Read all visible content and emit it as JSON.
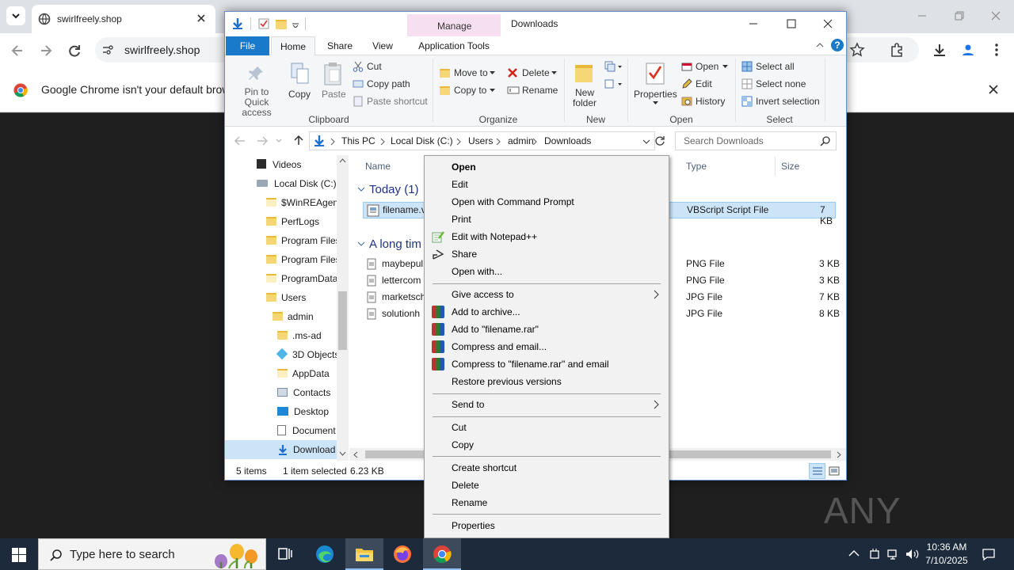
{
  "browser": {
    "tab_title": "swirlfreely.shop",
    "url": "swirlfreely.shop",
    "infobar_text": "Google Chrome isn't your default browser"
  },
  "explorer": {
    "title": "Downloads",
    "manage_tab": "Manage",
    "ribbon_tabs": [
      "File",
      "Home",
      "Share",
      "View",
      "Application Tools"
    ],
    "ribbon": {
      "pin": "Pin to Quick access",
      "copy": "Copy",
      "paste": "Paste",
      "cut": "Cut",
      "copy_path": "Copy path",
      "paste_shortcut": "Paste shortcut",
      "move_to": "Move to",
      "copy_to": "Copy to",
      "delete": "Delete",
      "rename": "Rename",
      "new_folder": "New folder",
      "properties": "Properties",
      "open": "Open",
      "edit": "Edit",
      "history": "History",
      "select_all": "Select all",
      "select_none": "Select none",
      "invert_selection": "Invert selection",
      "groups": [
        "Clipboard",
        "Organize",
        "New",
        "Open",
        "Select"
      ]
    },
    "breadcrumb": [
      "This PC",
      "Local Disk (C:)",
      "Users",
      "admin",
      "Downloads"
    ],
    "search_placeholder": "Search Downloads",
    "nav": [
      "Videos",
      "Local Disk (C:)",
      "$WinREAgent",
      "PerfLogs",
      "Program Files",
      "Program Files",
      "ProgramData",
      "Users",
      "admin",
      ".ms-ad",
      "3D Objects",
      "AppData",
      "Contacts",
      "Desktop",
      "Document",
      "Download"
    ],
    "columns": {
      "name": "Name",
      "type": "Type",
      "size": "Size"
    },
    "groups": {
      "today": "Today (1)",
      "long_time": "A long tim"
    },
    "files": [
      {
        "name": "filename.v",
        "type": "VBScript Script File",
        "size": "7 KB"
      },
      {
        "name": "maybepul",
        "type": "PNG File",
        "size": "3 KB"
      },
      {
        "name": "lettercom",
        "type": "PNG File",
        "size": "3 KB"
      },
      {
        "name": "marketsch",
        "type": "JPG File",
        "size": "7 KB"
      },
      {
        "name": "solutionh",
        "type": "JPG File",
        "size": "8 KB"
      }
    ],
    "status": {
      "count": "5 items",
      "selected": "1 item selected",
      "size": "6.23 KB"
    }
  },
  "context_menu": {
    "items": [
      "Open",
      "Edit",
      "Open with Command Prompt",
      "Print",
      "Edit with Notepad++",
      "Share",
      "Open with...",
      "Give access to",
      "Add to archive...",
      "Add to \"filename.rar\"",
      "Compress and email...",
      "Compress to \"filename.rar\" and email",
      "Restore previous versions",
      "Send to",
      "Cut",
      "Copy",
      "Create shortcut",
      "Delete",
      "Rename",
      "Properties"
    ]
  },
  "taskbar": {
    "search_placeholder": "Type here to search",
    "time": "10:36 AM",
    "date": "7/10/2025"
  },
  "watermark": "ANY RUN"
}
